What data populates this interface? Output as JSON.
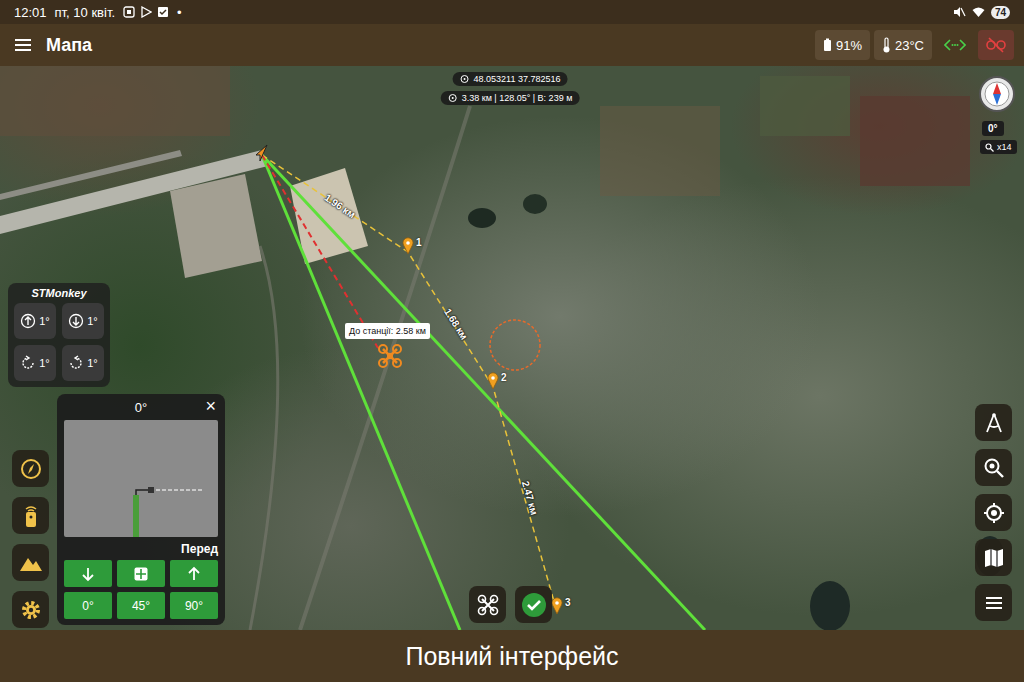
{
  "status_bar": {
    "time": "12:01",
    "date": "пт, 10 квіт.",
    "dot": "•",
    "battery": "74"
  },
  "app_bar": {
    "title": "Мапа",
    "battery": "91%",
    "temperature": "23°C"
  },
  "map": {
    "coordinates": "48.053211 37.782516",
    "target_info": "3.38 км | 128.05° | В: 239 м",
    "heading": "0°",
    "zoom": "x14",
    "tooltip": "До станції: 2.58 км",
    "segments": [
      {
        "label": "1.96 км"
      },
      {
        "label": "1.68 км"
      },
      {
        "label": "2.47 км"
      }
    ],
    "waypoints": [
      {
        "label": "1"
      },
      {
        "label": "2"
      },
      {
        "label": "3"
      }
    ]
  },
  "stmonkey": {
    "title": "STMonkey",
    "buttons": [
      {
        "label": "1°"
      },
      {
        "label": "1°"
      },
      {
        "label": "1°"
      },
      {
        "label": "1°"
      }
    ]
  },
  "camera_panel": {
    "angle": "0°",
    "close": "×",
    "view": "Перед",
    "presets": [
      "0°",
      "45°",
      "90°"
    ]
  },
  "caption": "Повний інтерфейс"
}
